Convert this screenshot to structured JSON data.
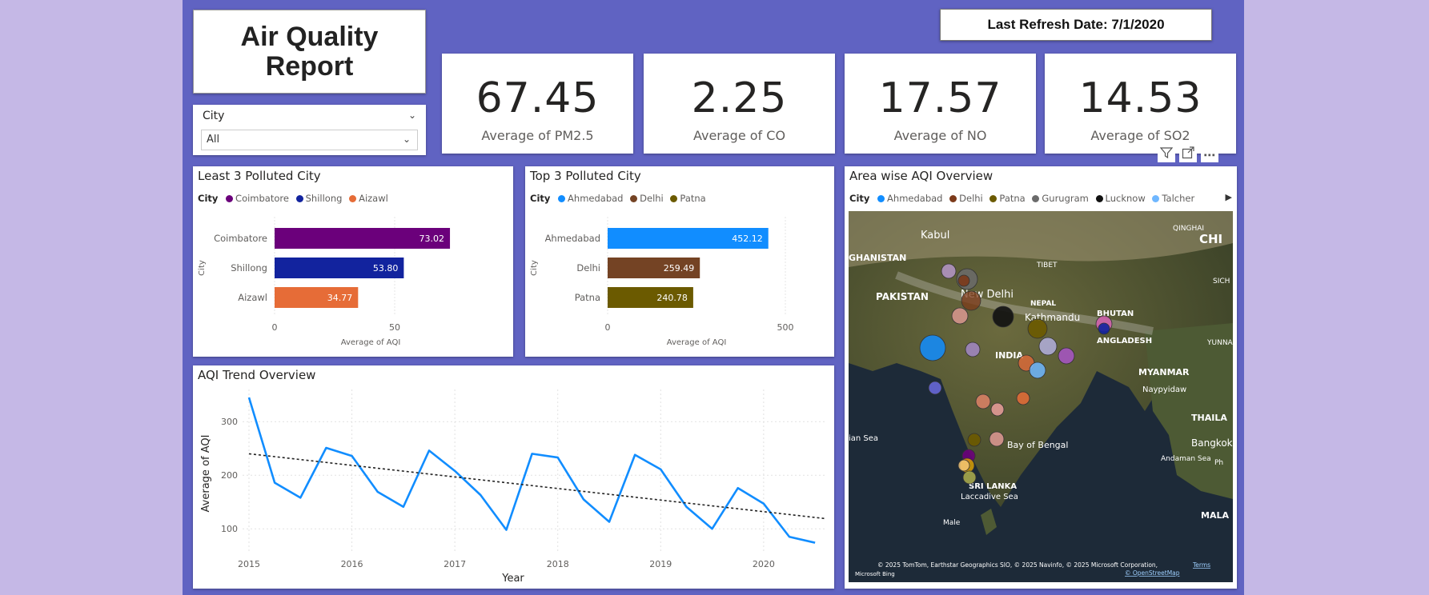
{
  "report": {
    "title": "Air Quality Report",
    "refresh_label": "Last Refresh Date: 7/1/2020"
  },
  "slicer": {
    "label": "City",
    "value": "All"
  },
  "kpis": [
    {
      "value": "67.45",
      "label": "Average of PM2.5"
    },
    {
      "value": "2.25",
      "label": "Average of CO"
    },
    {
      "value": "17.57",
      "label": "Average of NO"
    },
    {
      "value": "14.53",
      "label": "Average of SO2"
    }
  ],
  "visual_icons": {
    "filter": "filter-icon",
    "focus": "focus-mode-icon",
    "more": "more-options-icon"
  },
  "least": {
    "title": "Least 3 Polluted City",
    "legend_title": "City",
    "legend": [
      {
        "name": "Coimbatore",
        "color": "#6b007b"
      },
      {
        "name": "Shillong",
        "color": "#12239e"
      },
      {
        "name": "Aizawl",
        "color": "#e66c37"
      }
    ]
  },
  "top": {
    "title": "Top 3 Polluted City",
    "legend_title": "City",
    "legend": [
      {
        "name": "Ahmedabad",
        "color": "#118dff"
      },
      {
        "name": "Delhi",
        "color": "#744ec2"
      },
      {
        "name": "Patna",
        "color": "#6b5a00"
      }
    ]
  },
  "map": {
    "title": "Area wise AQI Overview",
    "legend_title": "City",
    "legend": [
      {
        "name": "Ahmedabad",
        "color": "#118dff"
      },
      {
        "name": "Delhi",
        "color": "#7c3a1a"
      },
      {
        "name": "Patna",
        "color": "#6b5a00"
      },
      {
        "name": "Gurugram",
        "color": "#6b6b6b"
      },
      {
        "name": "Lucknow",
        "color": "#111111"
      },
      {
        "name": "Talcher",
        "color": "#6fb7ff"
      }
    ],
    "labels": [
      "Kabul",
      "QINGHAI",
      "CHI",
      "GHANISTAN",
      "TIBET",
      "SICH",
      "PAKISTAN",
      "New Delhi",
      "NEPAL",
      "Kathmandu",
      "BHUTAN",
      "ANGLADESH",
      "YUNNA",
      "INDIA",
      "MYANMAR",
      "Naypyidaw",
      "THAILA",
      "Bay of Bengal",
      "Bangkok",
      "ian Sea",
      "Andaman Sea",
      "Ph",
      "SRI LANKA",
      "Laccadive Sea",
      "MALA",
      "Male"
    ],
    "attribution": "© 2025 TomTom, Earthstar Geographics SIO, © 2025 Navinfo, © 2025 Microsoft Corporation,",
    "terms": "Terms",
    "osm": "© OpenStreetMap",
    "bing": "Microsoft Bing"
  },
  "chart_data": [
    {
      "type": "bar",
      "title": "Least 3 Polluted City",
      "categories": [
        "Coimbatore",
        "Shillong",
        "Aizawl"
      ],
      "values": [
        73.02,
        53.8,
        34.77
      ],
      "labels": [
        "73.02",
        "53.80",
        "34.77"
      ],
      "colors": [
        "#6b007b",
        "#12239e",
        "#e66c37"
      ],
      "xlabel": "Average of AQI",
      "ylabel": "City",
      "xlim": [
        0,
        80
      ],
      "ticks": [
        0,
        50
      ]
    },
    {
      "type": "bar",
      "title": "Top 3 Polluted City",
      "categories": [
        "Ahmedabad",
        "Delhi",
        "Patna"
      ],
      "values": [
        452.12,
        259.49,
        240.78
      ],
      "labels": [
        "452.12",
        "259.49",
        "240.78"
      ],
      "colors": [
        "#118dff",
        "#744324",
        "#6b5a00"
      ],
      "xlabel": "Average of AQI",
      "ylabel": "City",
      "xlim": [
        0,
        500
      ],
      "ticks": [
        0,
        500
      ]
    },
    {
      "type": "line",
      "title": "AQI Trend Overview",
      "xlabel": "Year",
      "ylabel": "Average of AQI",
      "x": [
        2015.0,
        2015.25,
        2015.5,
        2015.75,
        2016.0,
        2016.25,
        2016.5,
        2016.75,
        2017.0,
        2017.25,
        2017.5,
        2017.75,
        2018.0,
        2018.25,
        2018.5,
        2018.75,
        2019.0,
        2019.25,
        2019.5,
        2019.75,
        2020.0,
        2020.25,
        2020.5
      ],
      "series": [
        {
          "values": [
            345,
            186,
            158,
            251,
            236,
            169,
            141,
            246,
            208,
            163,
            98,
            240,
            233,
            155,
            113,
            238,
            211,
            141,
            100,
            176,
            147,
            85,
            74
          ]
        }
      ],
      "trendline": [
        240,
        119
      ],
      "xlim": [
        2015,
        2020.6
      ],
      "ylim": [
        60,
        360
      ],
      "yticks": [
        100,
        200,
        300
      ],
      "xticks": [
        2015,
        2016,
        2017,
        2018,
        2019,
        2020
      ],
      "grid": true
    }
  ]
}
